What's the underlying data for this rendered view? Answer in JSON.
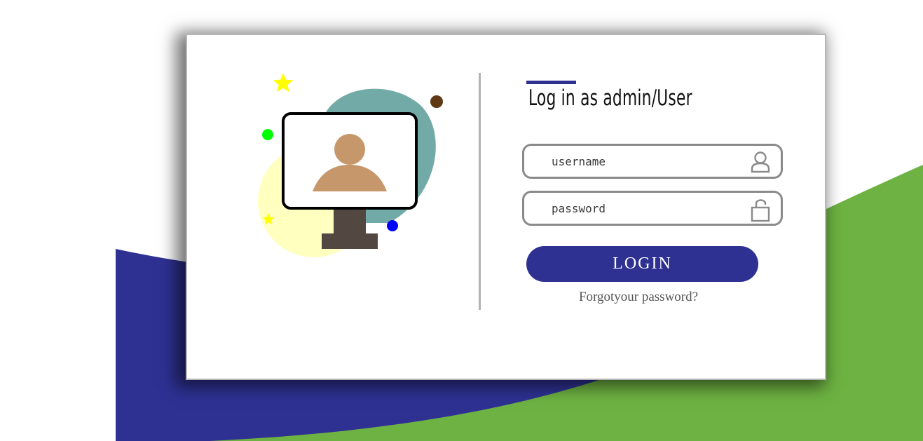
{
  "login": {
    "title": "Log in as admin/User",
    "username": {
      "placeholder": "username",
      "value": "",
      "icon": "user-icon"
    },
    "password": {
      "placeholder": "password",
      "value": "",
      "icon": "lock-icon"
    },
    "submit_label": "LOGIN",
    "forgot_label": "Forgotyour password?"
  },
  "illustration": {
    "subject": "monitor-user-avatar-icon"
  },
  "colors": {
    "accent": "#2e3192",
    "green": "#6db242",
    "teal": "#71aaa6",
    "light_yellow": "#ffffc0",
    "skin": "#c6976a",
    "stand": "#534741",
    "star_yellow": "#ffff00",
    "dot_green": "#00ff00",
    "dot_blue": "#0000ff",
    "dot_brown": "#603813"
  }
}
